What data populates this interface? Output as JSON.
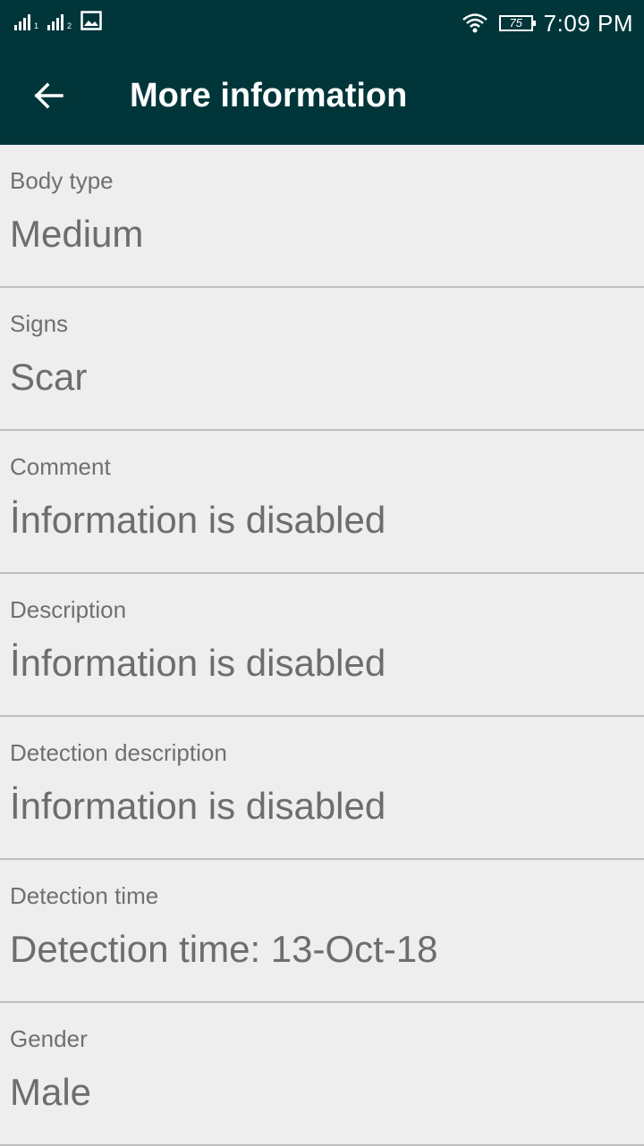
{
  "status_bar": {
    "sim1_label": "1",
    "sim2_label": "2",
    "battery_level": "75",
    "time": "7:09 PM",
    "icons": [
      "signal-sim1-icon",
      "signal-sim2-icon",
      "image-icon",
      "wifi-icon",
      "battery-icon"
    ]
  },
  "toolbar": {
    "title": "More information",
    "back_icon": "back-arrow-icon"
  },
  "colors": {
    "toolbar_bg": "#00363a",
    "page_bg": "#eeeeee",
    "label_text": "#707070",
    "value_text": "#6d6d6d",
    "divider": "#bdbdbd"
  },
  "items": [
    {
      "label": "Body type",
      "value": "Medium"
    },
    {
      "label": "Signs",
      "value": "Scar"
    },
    {
      "label": "Comment",
      "value": "İnformation is disabled"
    },
    {
      "label": "Description",
      "value": "İnformation is disabled"
    },
    {
      "label": "Detection description",
      "value": "İnformation is disabled"
    },
    {
      "label": "Detection time",
      "value": "Detection time: 13-Oct-18"
    },
    {
      "label": "Gender",
      "value": "Male"
    }
  ]
}
